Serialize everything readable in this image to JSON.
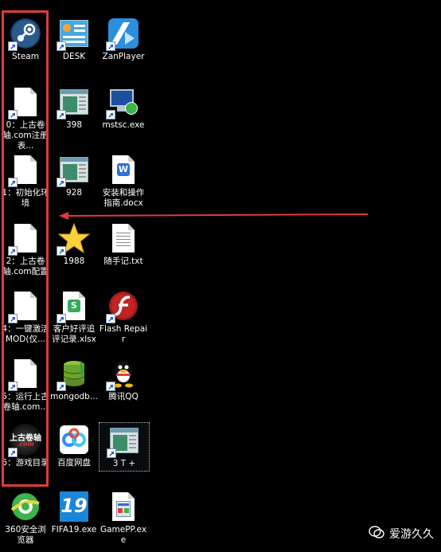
{
  "desktop": {
    "icons": [
      {
        "label": "Steam",
        "icon": "steam-icon"
      },
      {
        "label": "DESK",
        "icon": "desk-control-icon"
      },
      {
        "label": "ZanPlayer",
        "icon": "zanplayer-icon"
      },
      {
        "label": "0：上古卷轴.com注册表...",
        "icon": "document-icon"
      },
      {
        "label": "398",
        "icon": "window-app-icon"
      },
      {
        "label": "mstsc.exe",
        "icon": "remote-desktop-icon"
      },
      {
        "label": "1：初始化环境",
        "icon": "document-icon"
      },
      {
        "label": "928",
        "icon": "window-app-icon"
      },
      {
        "label": "安装和操作指南.docx",
        "icon": "word-document-icon"
      },
      {
        "label": "2：上古卷轴.com配置",
        "icon": "document-icon"
      },
      {
        "label": "1988",
        "icon": "star-icon"
      },
      {
        "label": "随手记.txt",
        "icon": "text-file-icon"
      },
      {
        "label": "4：一键激活MOD(仅...",
        "icon": "document-icon"
      },
      {
        "label": "客户好评追评记录.xlsx",
        "icon": "spreadsheet-icon"
      },
      {
        "label": "Flash Repair",
        "icon": "flash-icon"
      },
      {
        "label": "5：运行上古卷轴.com...",
        "icon": "document-icon"
      },
      {
        "label": "mongodb...",
        "icon": "mongodb-icon"
      },
      {
        "label": "腾讯QQ",
        "icon": "qq-penguin-icon"
      },
      {
        "label": "6：游戏目录",
        "icon": "skyrim-logo-icon"
      },
      {
        "label": "百度网盘",
        "icon": "baidu-netdisk-icon"
      },
      {
        "label": "3 T +",
        "icon": "window-app-icon"
      },
      {
        "label": "360安全浏览器",
        "icon": "browser-360-icon"
      },
      {
        "label": "FIFA19.exe",
        "icon": "fifa-icon"
      },
      {
        "label": "GamePP.exe",
        "icon": "gamepp-icon"
      }
    ],
    "skyrim_logo_text": "上古卷轴",
    "skyrim_logo_sub": ".com",
    "fifa_text": "19"
  },
  "annotations": {
    "box_color": "#e23a3a",
    "arrow_color": "#e23a3a"
  },
  "watermark": {
    "text": "爱游久久",
    "icon": "wechat-logo-icon"
  }
}
